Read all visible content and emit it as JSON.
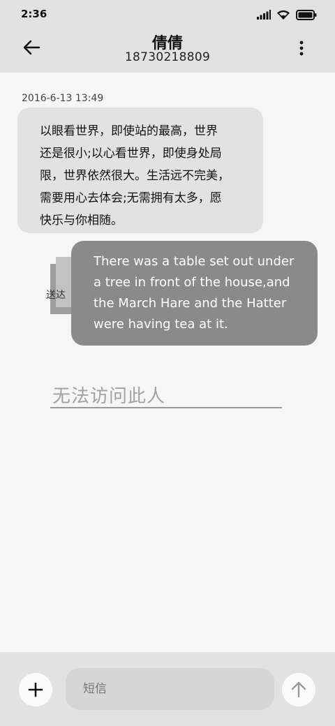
{
  "status_bar": {
    "time": "2:36",
    "icons": [
      "signal-icon",
      "wifi-icon",
      "battery-icon"
    ]
  },
  "header": {
    "contact_name": "倩倩",
    "phone_number": "18730218809",
    "icons": [
      "back-arrow-icon",
      "more-vertical-icon"
    ]
  },
  "messages": [
    {
      "direction": "incoming",
      "timestamp": "2016-6-13 13:49",
      "lines": [
        "以眼看世界，即使站的最高，世界",
        "还是很小;以心看世界，即使身处局",
        "限，世界依然很大。生活远不完美，",
        "需要用心去体会;无需拥有太多，愿",
        "快乐与你相随。"
      ]
    },
    {
      "direction": "outgoing",
      "status": "送达",
      "lines": [
        "There was a table set out under",
        "a tree in front of the house,and",
        "the March Hare and the Hatter",
        "were having tea at it."
      ]
    }
  ],
  "notice": {
    "blocked_text": "无法访问此人"
  },
  "composer": {
    "placeholder": "短信",
    "icons": [
      "plus-icon",
      "send-arrow-up-icon"
    ]
  },
  "colors": {
    "bar_background": "#e2e2e2",
    "page_background": "#f6f6f6",
    "incoming_bubble": "#e2e2e2",
    "outgoing_bubble": "#8a8a8a"
  }
}
